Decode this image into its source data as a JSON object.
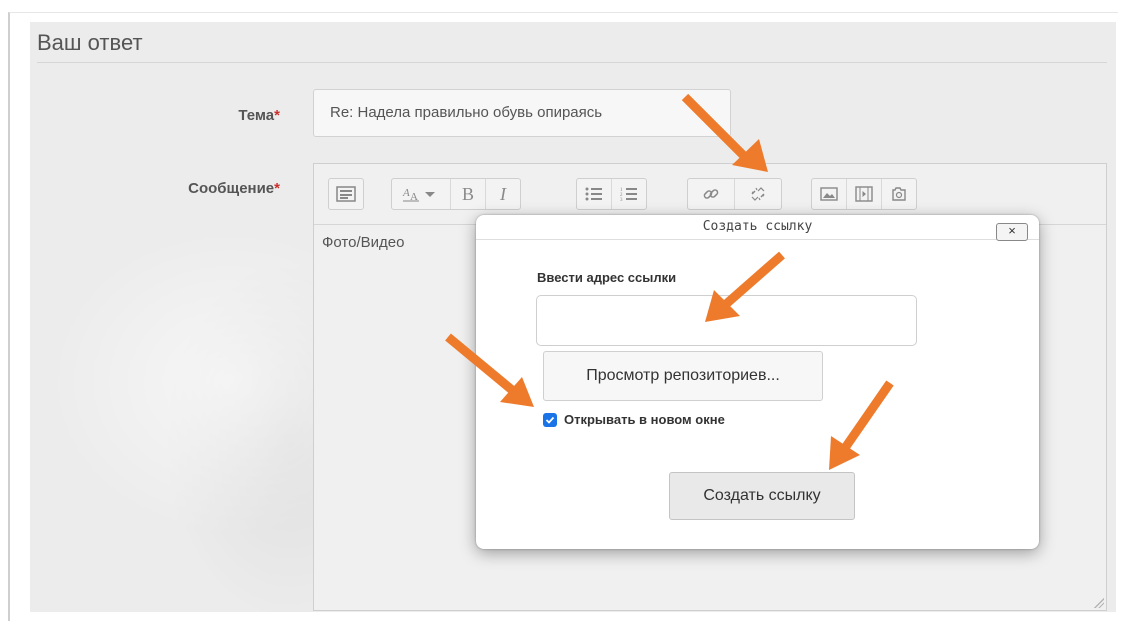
{
  "section": {
    "title": "Ваш ответ"
  },
  "form": {
    "subject_label": "Тема",
    "subject_value": "Re: Надела правильно обувь опираясь",
    "message_label": "Сообщение",
    "required_mark": "*",
    "message_value": "Фото/Видео"
  },
  "toolbar": {
    "icons": [
      "toolbar-toggle-icon",
      "font-style-icon",
      "bold-icon",
      "italic-icon",
      "unordered-list-icon",
      "ordered-list-icon",
      "link-icon",
      "unlink-icon",
      "image-icon",
      "media-icon",
      "manage-files-icon"
    ],
    "bold_glyph": "B",
    "italic_glyph": "I"
  },
  "dialog": {
    "title": "Создать ссылку",
    "close_glyph": "×",
    "url_label": "Ввести адрес ссылки",
    "url_value": "",
    "browse_label": "Просмотр репозиториев...",
    "new_window_label": "Открывать в новом окне",
    "new_window_checked": true,
    "create_label": "Создать ссылку"
  },
  "colors": {
    "arrow": "#ee7b2c",
    "checkbox": "#1b73e8",
    "required": "#c9302c"
  }
}
